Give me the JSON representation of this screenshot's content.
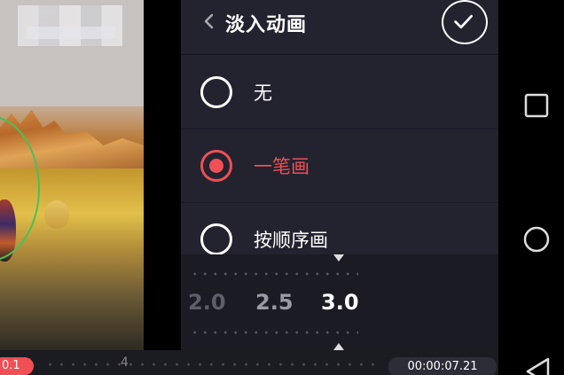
{
  "header": {
    "title": "淡入动画",
    "back_icon": "chevron-left-icon",
    "confirm_icon": "checkmark-icon"
  },
  "options": [
    {
      "label": "无",
      "selected": false
    },
    {
      "label": "一笔画",
      "selected": true
    },
    {
      "label": "按顺序画",
      "selected": false
    }
  ],
  "duration": {
    "values": [
      "2.0",
      "2.5",
      "3.0"
    ],
    "selected": "3.0"
  },
  "timeline": {
    "badge": "0.1",
    "marker": "4",
    "timecode": "00:00:07.21"
  },
  "navbar": {
    "icons": [
      "recent-apps-icon",
      "home-icon",
      "back-icon"
    ]
  },
  "colors": {
    "accent": "#ef4f55",
    "panel": "#232330",
    "ring": "#46c15a"
  }
}
